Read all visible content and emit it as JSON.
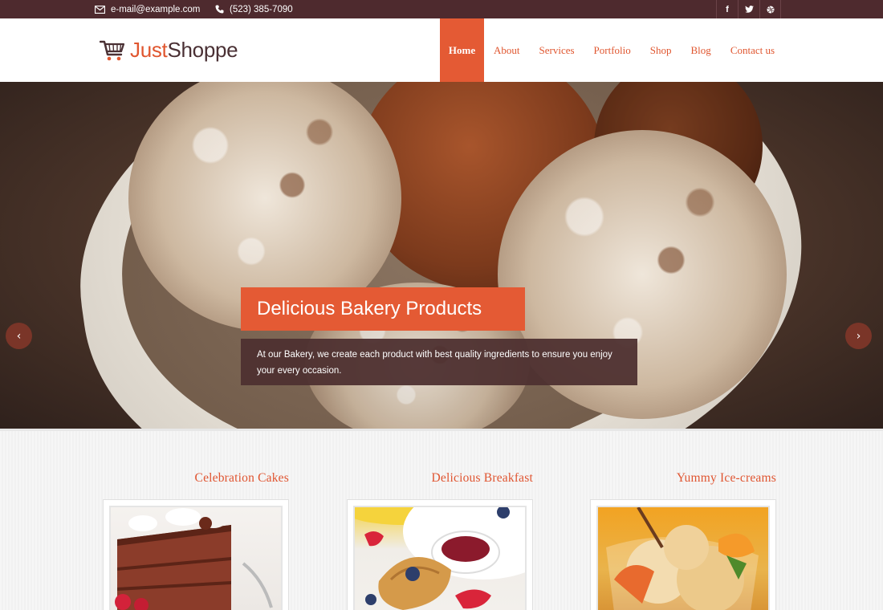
{
  "topbar": {
    "email": "e-mail@example.com",
    "phone": "(523) 385-7090",
    "social": [
      {
        "icon": "facebook-icon",
        "glyph": "f"
      },
      {
        "icon": "twitter-icon",
        "glyph": "t"
      },
      {
        "icon": "dribbble-icon",
        "glyph": "◉"
      }
    ]
  },
  "header": {
    "logo_just": "Just",
    "logo_shoppe": "Shoppe",
    "nav": [
      "Home",
      "About",
      "Services",
      "Portfolio",
      "Shop",
      "Blog",
      "Contact us"
    ],
    "active_nav": "Home"
  },
  "hero": {
    "title": "Delicious Bakery Products",
    "description": "At our Bakery, we create each product with best quality ingredients to ensure you enjoy your every occasion.",
    "prev_glyph": "‹",
    "next_glyph": "›",
    "scroll_glyph": "»"
  },
  "services": [
    {
      "title": "Celebration Cakes"
    },
    {
      "title": "Delicious Breakfast"
    },
    {
      "title": "Yummy Ice-creams"
    }
  ],
  "colors": {
    "accent": "#e45a34",
    "topbar": "#4e2a2e",
    "dark": "#4a3034"
  }
}
